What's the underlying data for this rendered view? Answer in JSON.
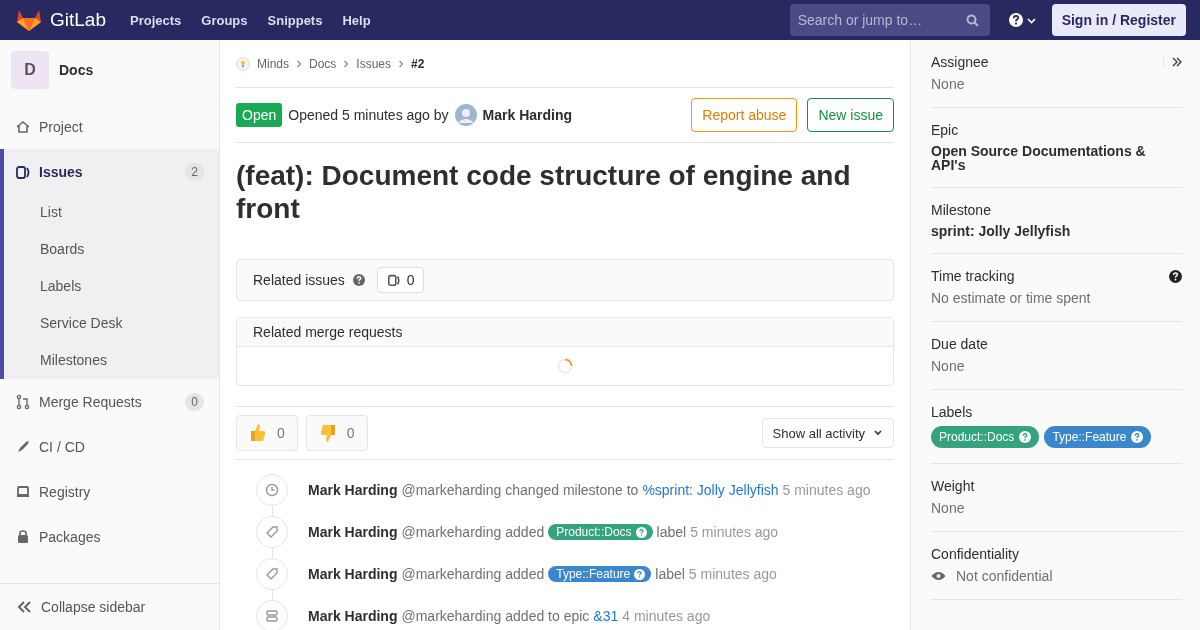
{
  "header": {
    "brand": "GitLab",
    "nav": [
      "Projects",
      "Groups",
      "Snippets",
      "Help"
    ],
    "search": {
      "placeholder": "Search or jump to…"
    },
    "sign_in": "Sign in / Register"
  },
  "sidebar": {
    "project": {
      "avatar": "D",
      "name": "Docs"
    },
    "items": [
      {
        "kind": "project",
        "label": "Project",
        "selected": false
      },
      {
        "kind": "issues",
        "label": "Issues",
        "count": "2",
        "selected": true,
        "children": [
          {
            "label": "List"
          },
          {
            "label": "Boards"
          },
          {
            "label": "Labels"
          },
          {
            "label": "Service Desk"
          },
          {
            "label": "Milestones"
          }
        ]
      },
      {
        "kind": "merge",
        "label": "Merge Requests",
        "count": "0",
        "selected": false
      },
      {
        "kind": "cicd",
        "label": "CI / CD",
        "selected": false
      },
      {
        "kind": "registry",
        "label": "Registry",
        "selected": false
      },
      {
        "kind": "packages",
        "label": "Packages",
        "selected": false
      }
    ],
    "collapse": "Collapse sidebar"
  },
  "breadcrumbs": [
    "Minds",
    "Docs",
    "Issues",
    "#2"
  ],
  "issue": {
    "status": "Open",
    "opened": "Opened 5 minutes ago by",
    "author": "Mark Harding",
    "buttons": [
      "Report abuse",
      "New issue"
    ],
    "title": "(feat): Document code structure of engine and front"
  },
  "related_issues": {
    "title": "Related issues",
    "count": "0"
  },
  "related_merge_requests": {
    "title": "Related merge requests"
  },
  "awards": [
    {
      "kind": "thumbsup",
      "count": "0"
    },
    {
      "kind": "thumbsdown",
      "count": "0"
    }
  ],
  "activity_filter": "Show all activity",
  "activity": [
    {
      "kind": "milestone",
      "author": "Mark Harding",
      "handle": "@markeharding",
      "action": "changed milestone to",
      "link": "%sprint: Jolly Jellyfish",
      "time": "5 minutes ago"
    },
    {
      "kind": "label",
      "author": "Mark Harding",
      "handle": "@markeharding",
      "action": "added",
      "label": {
        "text": "Product::Docs",
        "color": "#34a37e"
      },
      "suffix": "label",
      "time": "5 minutes ago"
    },
    {
      "kind": "label",
      "author": "Mark Harding",
      "handle": "@markeharding",
      "action": "added",
      "label": {
        "text": "Type::Feature",
        "color": "#3a87cc"
      },
      "suffix": "label",
      "time": "5 minutes ago"
    },
    {
      "kind": "epic",
      "author": "Mark Harding",
      "handle": "@markeharding",
      "action": "added to epic",
      "link": "&31",
      "time": "4 minutes ago"
    }
  ],
  "right_sidebar": [
    {
      "kind": "text",
      "title": "Assignee",
      "value": "None",
      "collapse": true
    },
    {
      "kind": "bold",
      "title": "Epic",
      "value": "Open Source Documentations & API's"
    },
    {
      "kind": "bold",
      "title": "Milestone",
      "value": "sprint: Jolly Jellyfish"
    },
    {
      "kind": "text",
      "title": "Time tracking",
      "value": "No estimate or time spent",
      "help": true
    },
    {
      "kind": "text",
      "title": "Due date",
      "value": "None"
    },
    {
      "kind": "labels",
      "title": "Labels",
      "labels": [
        {
          "text": "Product::Docs",
          "color": "#34a37e"
        },
        {
          "text": "Type::Feature",
          "color": "#3a87cc"
        }
      ]
    },
    {
      "kind": "text",
      "title": "Weight",
      "value": "None"
    },
    {
      "kind": "confidential",
      "title": "Confidentiality",
      "value": "Not confidential"
    }
  ]
}
